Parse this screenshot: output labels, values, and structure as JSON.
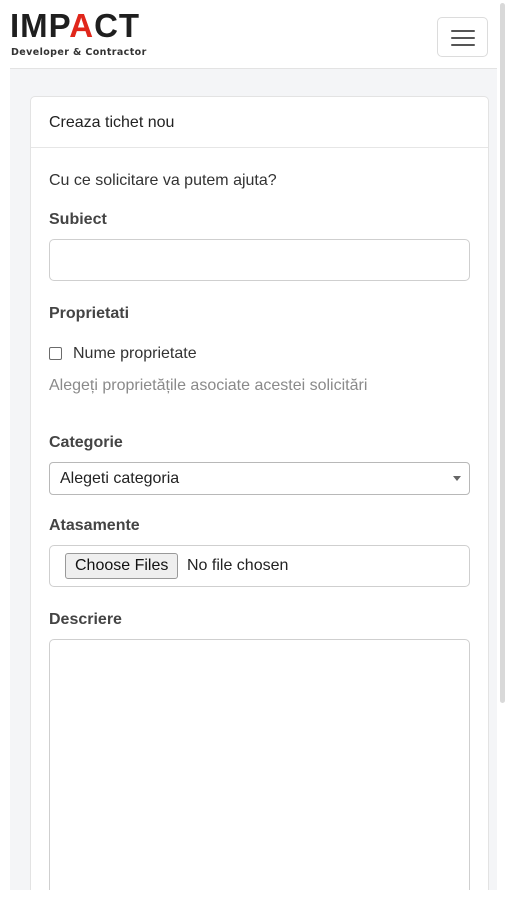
{
  "brand": {
    "logo_part1": "IMP",
    "logo_part2": "A",
    "logo_part3": "CT",
    "tagline": "Developer & Contractor",
    "accent_color": "#e0261b"
  },
  "navbar": {
    "menu_icon": "hamburger-icon"
  },
  "card": {
    "header": "Creaza tichet nou",
    "prompt": "Cu ce solicitare va putem ajuta?"
  },
  "form": {
    "subject_label": "Subiect",
    "subject_value": "",
    "properties_label": "Proprietati",
    "property_option": "Nume proprietate",
    "property_checked": false,
    "properties_help": "Alegeți proprietățile asociate acestei solicitări",
    "category_label": "Categorie",
    "category_selected": "Alegeti categoria",
    "attachments_label": "Atasamente",
    "file_button": "Choose Files",
    "file_status": "No file chosen",
    "description_label": "Descriere",
    "description_value": ""
  }
}
